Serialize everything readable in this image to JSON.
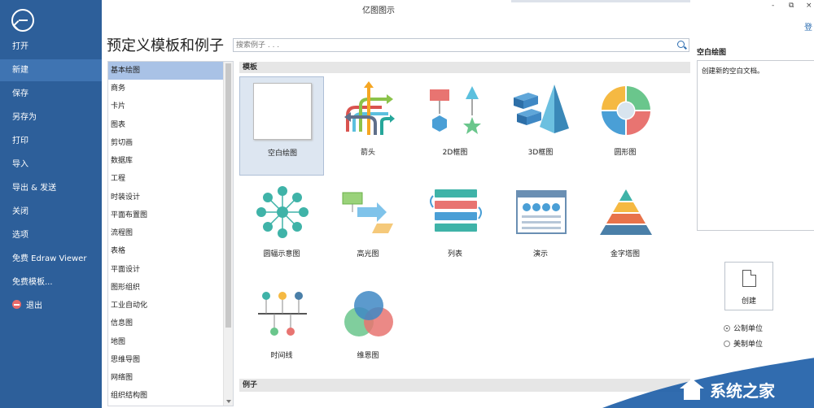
{
  "window": {
    "title": "亿图图示",
    "controls": [
      "-",
      "⧉",
      "×"
    ],
    "login": "登"
  },
  "sidebar": {
    "items": [
      {
        "label": "打开"
      },
      {
        "label": "新建"
      },
      {
        "label": "保存"
      },
      {
        "label": "另存为"
      },
      {
        "label": "打印"
      },
      {
        "label": "导入"
      },
      {
        "label": "导出 & 发送"
      },
      {
        "label": "关闭"
      },
      {
        "label": "选项"
      },
      {
        "label": "免费 Edraw Viewer"
      },
      {
        "label": "免费模板..."
      },
      {
        "label": "退出"
      }
    ],
    "active_index": 1
  },
  "main": {
    "title": "预定义模板和例子",
    "search_placeholder": "搜索例子 . . .",
    "categories": [
      "基本绘图",
      "商务",
      "卡片",
      "图表",
      "剪切画",
      "数据库",
      "工程",
      "时装设计",
      "平面布置图",
      "流程图",
      "表格",
      "平面设计",
      "图形组织",
      "工业自动化",
      "信息图",
      "地图",
      "思维导图",
      "网络图",
      "组织结构图"
    ],
    "selected_category": "基本绘图",
    "templates_header": "模板",
    "examples_header": "例子",
    "templates": [
      {
        "label": "空白绘图"
      },
      {
        "label": "箭头"
      },
      {
        "label": "2D框图"
      },
      {
        "label": "3D框图"
      },
      {
        "label": "圆形图"
      },
      {
        "label": "圆辐示意图"
      },
      {
        "label": "高光图"
      },
      {
        "label": "列表"
      },
      {
        "label": "演示"
      },
      {
        "label": "金字塔图"
      },
      {
        "label": "时间线"
      },
      {
        "label": "维恩图"
      }
    ]
  },
  "preview": {
    "title": "空白绘图",
    "description": "创建新的空白文档。",
    "create_label": "创建",
    "unit_metric": "公制单位",
    "unit_us": "美制单位"
  },
  "watermark": {
    "text": "系统之家"
  }
}
